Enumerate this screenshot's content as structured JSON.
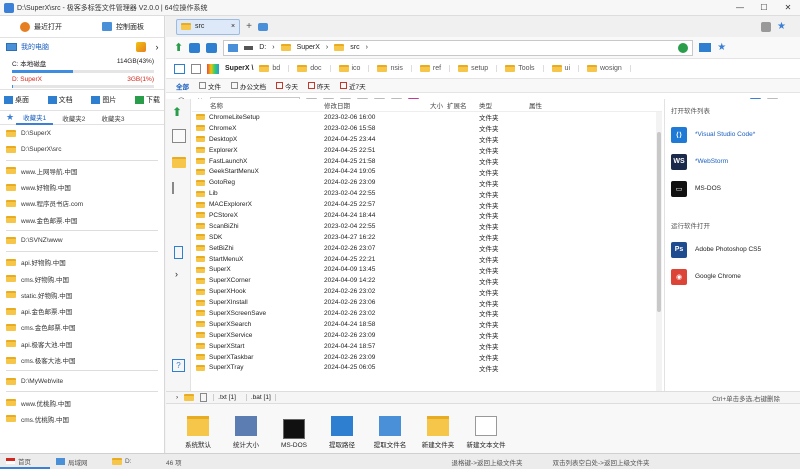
{
  "window": {
    "title": "D:\\SuperX\\src - 极客多标签文件管理器 V2.0.0  |  64位操作系统",
    "min": "—",
    "max": "☐",
    "close": "✕"
  },
  "left": {
    "recent_open": "最近打开",
    "control_panel": "控制面板",
    "my_computer": "我的电脑",
    "drives": [
      {
        "label": "C: 本地磁盘",
        "size": "114GB(43%)",
        "percent": 43,
        "color": "#3f8de0",
        "text_color": "#222"
      },
      {
        "label": "D: SuperX",
        "size": "3GB(1%)",
        "percent": 1,
        "color": "#3f8de0",
        "text_color": "#d0261c"
      }
    ],
    "quick": [
      "桌面",
      "文档",
      "图片",
      "下载"
    ],
    "fav_tabs": [
      "收藏夹1",
      "收藏夹2",
      "收藏夹3"
    ],
    "fav_groups": [
      [
        {
          "type": "folder",
          "label": "D:\\SuperX"
        },
        {
          "type": "folder",
          "label": "D:\\SuperX\\src"
        }
      ],
      [
        {
          "type": "web",
          "label": "www.上网导航.中国"
        },
        {
          "type": "web",
          "label": "www.好物购.中国"
        },
        {
          "type": "web",
          "label": "www.程序员书店.com"
        },
        {
          "type": "web",
          "label": "www.金色邮票.中国"
        }
      ],
      [
        {
          "type": "folder",
          "label": "D:\\SVNZ\\www"
        }
      ],
      [
        {
          "type": "web",
          "label": "api.好物购.中国"
        },
        {
          "type": "web",
          "label": "cms.好物购.中国"
        },
        {
          "type": "web",
          "label": "static.好物购.中国"
        },
        {
          "type": "web",
          "label": "api.金色邮票.中国"
        },
        {
          "type": "web",
          "label": "cms.金色邮票.中国"
        },
        {
          "type": "web",
          "label": "api.极客大池.中国"
        },
        {
          "type": "web",
          "label": "cms.极客大池.中国"
        }
      ],
      [
        {
          "type": "folder",
          "label": "D:\\MyWeb\\vite"
        }
      ],
      [
        {
          "type": "web",
          "label": "www.优桃购.中国"
        },
        {
          "type": "web",
          "label": "cms.优桃购.中国"
        }
      ]
    ]
  },
  "main": {
    "tab_label": "src",
    "tab_close": "×",
    "tab_add": "+",
    "address": {
      "drive": "D:",
      "parts": [
        "SuperX",
        "src"
      ]
    },
    "subfolders": {
      "root": "SuperX \\",
      "items": [
        "bd",
        "doc",
        "ico",
        "nsis",
        "ref",
        "setup",
        "Tools",
        "ui",
        "wosign"
      ]
    },
    "filters": [
      "全部",
      "文件",
      "办公文档",
      "今天",
      "昨天",
      "近7天"
    ],
    "search_placeholder": "筛选",
    "columns": {
      "name": "名称",
      "date": "修改日期",
      "size": "大小",
      "ext": "扩展名",
      "type": "类型",
      "attr": "属性"
    },
    "files": [
      {
        "name": "ChromeLiteSetup",
        "date": "2023-02-06 16:00",
        "type": "文件夹"
      },
      {
        "name": "ChromeX",
        "date": "2023-02-06 15:58",
        "type": "文件夹"
      },
      {
        "name": "DesktopX",
        "date": "2024-04-25 23:44",
        "type": "文件夹"
      },
      {
        "name": "ExplorerX",
        "date": "2024-04-25 22:51",
        "type": "文件夹"
      },
      {
        "name": "FastLaunchX",
        "date": "2024-04-25 21:58",
        "type": "文件夹"
      },
      {
        "name": "GeekStartMenuX",
        "date": "2024-04-24 19:05",
        "type": "文件夹"
      },
      {
        "name": "GotoReg",
        "date": "2024-02-26 23:09",
        "type": "文件夹"
      },
      {
        "name": "Lib",
        "date": "2023-02-04 22:55",
        "type": "文件夹"
      },
      {
        "name": "MACExplorerX",
        "date": "2024-04-25 22:57",
        "type": "文件夹"
      },
      {
        "name": "PCStoreX",
        "date": "2024-04-24 18:44",
        "type": "文件夹"
      },
      {
        "name": "ScanBiZhi",
        "date": "2023-02-04 22:55",
        "type": "文件夹"
      },
      {
        "name": "SDK",
        "date": "2023-04-27 16:22",
        "type": "文件夹"
      },
      {
        "name": "SetBiZhi",
        "date": "2024-02-26 23:07",
        "type": "文件夹"
      },
      {
        "name": "StartMenuX",
        "date": "2024-04-25 22:21",
        "type": "文件夹"
      },
      {
        "name": "SuperX",
        "date": "2024-04-09 13:45",
        "type": "文件夹"
      },
      {
        "name": "SuperXCorner",
        "date": "2024-04-09 14:22",
        "type": "文件夹"
      },
      {
        "name": "SuperXHook",
        "date": "2024-02-26 23:02",
        "type": "文件夹"
      },
      {
        "name": "SuperXInstall",
        "date": "2024-02-26 23:06",
        "type": "文件夹"
      },
      {
        "name": "SuperXScreenSave",
        "date": "2024-02-26 23:02",
        "type": "文件夹"
      },
      {
        "name": "SuperXSearch",
        "date": "2024-04-24 18:58",
        "type": "文件夹"
      },
      {
        "name": "SuperXService",
        "date": "2024-02-26 23:09",
        "type": "文件夹"
      },
      {
        "name": "SuperXStart",
        "date": "2024-04-24 18:57",
        "type": "文件夹"
      },
      {
        "name": "SuperXTaskbar",
        "date": "2024-02-26 23:09",
        "type": "文件夹"
      },
      {
        "name": "SuperXTray",
        "date": "2024-04-25 06:05",
        "type": "文件夹"
      }
    ],
    "apps_open_label": "打开软件列表",
    "apps_open": [
      {
        "name": "*Visual Studio Code*",
        "color": "#1f7ad6",
        "glyph": "⟨⟩",
        "text_color": "#1a5fbf"
      },
      {
        "name": "*WebStorm",
        "color": "#1b2a4a",
        "glyph": "WS",
        "text_color": "#1a5fbf"
      },
      {
        "name": "MS-DOS",
        "color": "#111111",
        "glyph": "▭",
        "text_color": "#222"
      }
    ],
    "apps_run_label": "运行软件打开",
    "apps_run": [
      {
        "name": "Adobe Photoshop CS5",
        "color": "#1f4c8f",
        "glyph": "Ps",
        "text_color": "#222"
      },
      {
        "name": "Google Chrome",
        "color": "#db4437",
        "glyph": "◉",
        "text_color": "#222"
      }
    ],
    "bottom_tabs": [
      ".txt [1]",
      ".bat [1]"
    ],
    "bottom_hint": "Ctrl+单击多选,右键删除",
    "tools": [
      "系统默认",
      "统计大小",
      "MS-DOS",
      "提取路径",
      "提取文件名",
      "新建文件夹",
      "新建文本文件"
    ]
  },
  "status": {
    "home": "首页",
    "lan": "局域网",
    "d": "D:",
    "count": "46 项",
    "hint1": "退格键->返回上级文件夹",
    "hint2": "双击列表空白处->返回上级文件夹"
  }
}
